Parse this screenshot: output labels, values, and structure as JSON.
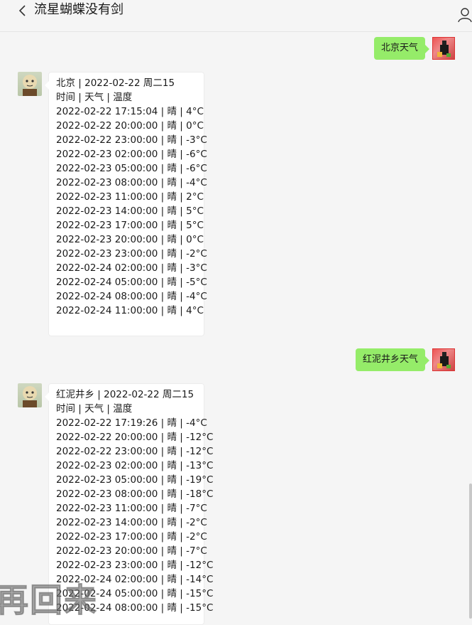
{
  "header": {
    "title": "流星蝴蝶没有剑",
    "back_icon": "chevron-left-icon",
    "profile_icon": "person-icon"
  },
  "messages": [
    {
      "from": "me",
      "text": "北京天气"
    },
    {
      "from": "bot",
      "lines": [
        "北京 | 2022-02-22 周二15",
        "时间 | 天气 | 温度",
        "2022-02-22 17:15:04 | 晴 | 4°C",
        "2022-02-22 20:00:00 | 晴 | 0°C",
        "2022-02-22 23:00:00 | 晴 | -3°C",
        "2022-02-23 02:00:00 | 晴 | -6°C",
        "2022-02-23 05:00:00 | 晴 | -6°C",
        "2022-02-23 08:00:00 | 晴 | -4°C",
        "2022-02-23 11:00:00 | 晴 | 2°C",
        "2022-02-23 14:00:00 | 晴 | 5°C",
        "2022-02-23 17:00:00 | 晴 | 5°C",
        "2022-02-23 20:00:00 | 晴 | 0°C",
        "2022-02-23 23:00:00 | 晴 | -2°C",
        "2022-02-24 02:00:00 | 晴 | -3°C",
        "2022-02-24 05:00:00 | 晴 | -5°C",
        "2022-02-24 08:00:00 | 晴 | -4°C",
        "2022-02-24 11:00:00 | 晴 | 4°C"
      ]
    },
    {
      "from": "me",
      "text": "红泥井乡天气"
    },
    {
      "from": "bot",
      "lines": [
        "红泥井乡 | 2022-02-22 周二15",
        "时间 | 天气 | 温度",
        "2022-02-22 17:19:26 | 晴 | -4°C",
        "2022-02-22 20:00:00 | 晴 | -12°C",
        "2022-02-22 23:00:00 | 晴 | -12°C",
        "2022-02-23 02:00:00 | 晴 | -13°C",
        "2022-02-23 05:00:00 | 晴 | -19°C",
        "2022-02-23 08:00:00 | 晴 | -18°C",
        "2022-02-23 11:00:00 | 晴 | -7°C",
        "2022-02-23 14:00:00 | 晴 | -2°C",
        "2022-02-23 17:00:00 | 晴 | -2°C",
        "2022-02-23 20:00:00 | 晴 | -7°C",
        "2022-02-23 23:00:00 | 晴 | -12°C",
        "2022-02-24 02:00:00 | 晴 | -14°C",
        "2022-02-24 05:00:00 | 晴 | -15°C",
        "2022-02-24 08:00:00 | 晴 | -15°C"
      ]
    }
  ],
  "watermark": "再回来",
  "colors": {
    "background": "#f5f5f5",
    "my_bubble": "#95ec69",
    "bot_bubble": "#ffffff"
  }
}
